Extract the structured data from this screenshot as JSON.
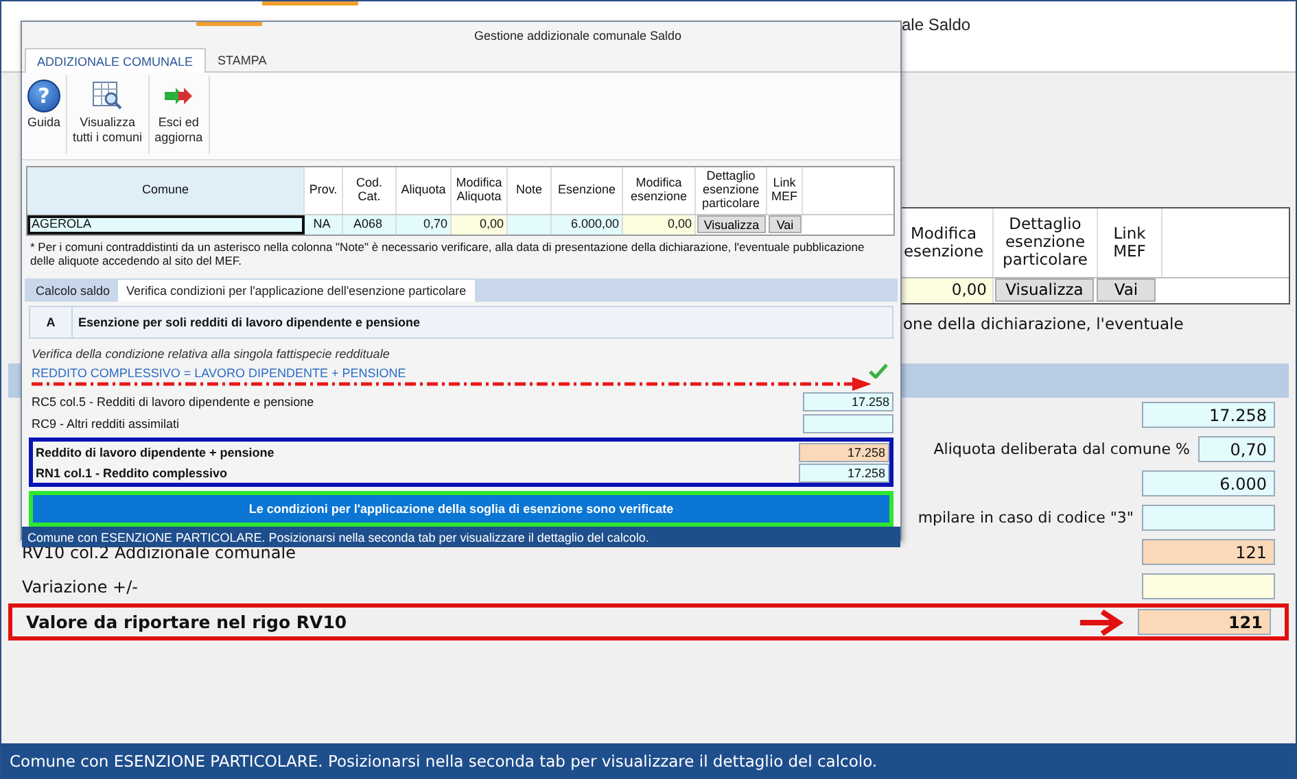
{
  "window": {
    "title_fragment": "ale Saldo"
  },
  "municipality_table": {
    "columns": [
      "Modifica\nesenzione",
      "Dettaglio\nesenzione\nparticolare",
      "Link\nMEF"
    ],
    "row": [
      {
        "kind": "input",
        "text": "0,00"
      },
      {
        "kind": "button",
        "text": "Visualizza"
      },
      {
        "kind": "button",
        "text": "Vai"
      }
    ]
  },
  "note_fragment": "one della dichiarazione, l'eventuale",
  "fields": [
    {
      "kind": "calc",
      "value": "17.258"
    },
    {
      "kind": "rate",
      "label": "Aliquota deliberata dal comune %",
      "value": "0,70"
    },
    {
      "kind": "calc",
      "value": "6.000"
    },
    {
      "kind": "code",
      "label": "mpilare in caso di codice \"3\""
    },
    {
      "kind": "result",
      "label": "RV10 col.2 Addizionale comunale",
      "value": "121"
    },
    {
      "kind": "input",
      "label": "Variazione +/-"
    },
    {
      "kind": "total",
      "label": "Valore da riportare nel rigo RV10",
      "value": "121"
    }
  ],
  "status_bar": "Comune con ESENZIONE PARTICOLARE. Posizionarsi nella seconda tab per visualizzare il dettaglio del calcolo.",
  "dialog": {
    "title": "Gestione addizionale comunale Saldo",
    "ribbon_tabs": [
      {
        "label": "ADDIZIONALE COMUNALE",
        "selected": true
      },
      {
        "label": "STAMPA",
        "selected": false
      }
    ],
    "ribbon_buttons": [
      {
        "kind": "help",
        "glyph": "?",
        "label": "Guida"
      },
      {
        "kind": "view-all",
        "label": "Visualizza\ntutti i comuni"
      },
      {
        "kind": "exit",
        "label": "Esci ed\naggiorna"
      }
    ],
    "grid": {
      "columns": [
        "Comune",
        "Prov.",
        "Cod.\nCat.",
        "Aliquota",
        "Modifica\nAliquota",
        "Note",
        "Esenzione",
        "Modifica\nesenzione",
        "Dettaglio\nesenzione\nparticolare",
        "Link\nMEF"
      ],
      "row": [
        {
          "kind": "name",
          "text": "AGEROLA"
        },
        {
          "kind": "plain",
          "text": "NA"
        },
        {
          "kind": "plain",
          "text": "A068"
        },
        {
          "kind": "calc",
          "text": "0,70"
        },
        {
          "kind": "input",
          "text": "0,00"
        },
        {
          "kind": "calc"
        },
        {
          "kind": "calc",
          "text": "6.000,00"
        },
        {
          "kind": "input",
          "text": "0,00"
        },
        {
          "kind": "button",
          "text": "Visualizza"
        },
        {
          "kind": "button",
          "text": "Vai"
        }
      ]
    },
    "note": "* Per i comuni contraddistinti da un asterisco nella colonna \"Note\" è necessario verificare,  alla data di presentazione della dichiarazione, l'eventuale pubblicazione delle aliquote accedendo al sito del MEF.",
    "tabs": [
      {
        "label": "Calcolo saldo",
        "selected": false
      },
      {
        "label": "Verifica condizioni per l'applicazione dell'esenzione particolare",
        "selected": true
      }
    ],
    "section": {
      "letter": "A",
      "title": "Esenzione per soli redditi di lavoro dipendente e pensione"
    },
    "subtitle": "Verifica della condizione relativa alla singola fattispecie reddituale",
    "condition": {
      "text": "REDDITO COMPLESSIVO = LAVORO DIPENDENTE + PENSIONE",
      "verified": true
    },
    "lines": [
      {
        "kind": "calc",
        "label": "RC5 col.5 - Redditi di lavoro dipendente e pensione",
        "value": "17.258"
      },
      {
        "kind": "calc",
        "label": "RC9 - Altri redditi assimilati"
      }
    ],
    "comparison": [
      {
        "kind": "result",
        "label": "Reddito di lavoro dipendente + pensione",
        "value": "17.258"
      },
      {
        "kind": "calc",
        "label": "RN1 col.1 - Reddito complessivo",
        "value": "17.258"
      }
    ],
    "result_button": "Le condizioni per l'applicazione della soglia di esenzione sono verificate",
    "status_bar": "Comune con ESENZIONE PARTICOLARE. Posizionarsi nella seconda tab per visualizzare il dettaglio del calcolo."
  }
}
